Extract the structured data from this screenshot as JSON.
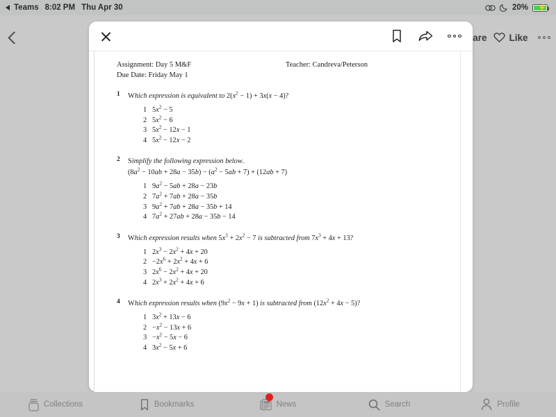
{
  "status_bar": {
    "back_app": "Teams",
    "time": "8:02 PM",
    "date": "Thu Apr 30",
    "battery_percent": "20%",
    "icons": [
      "link-icon",
      "moon-icon",
      "battery-charging-icon"
    ]
  },
  "page_toolbar": {
    "back_label": "",
    "share_label": "Share",
    "like_label": "Like",
    "more_label": ""
  },
  "modal": {
    "close_label": "",
    "bookmark_label": "",
    "share_label": "",
    "more_label": ""
  },
  "document": {
    "assignment": "Assignment: Day 5 M&F",
    "teacher": "Teacher: Candreva/Peterson",
    "due_date": "Due Date: Friday May 1",
    "questions": [
      {
        "number": "1",
        "prompt": "Which expression is equivalent to 2(x² − 1) + 3x(x − 4)?",
        "subline": "",
        "choices": [
          {
            "n": "1",
            "text": "5x² − 5"
          },
          {
            "n": "2",
            "text": "5x² − 6"
          },
          {
            "n": "3",
            "text": "5x² − 12x − 1"
          },
          {
            "n": "4",
            "text": "5x² − 12x − 2"
          }
        ]
      },
      {
        "number": "2",
        "prompt": "Simplify the following expression below.",
        "subline": "(8a² − 10ab + 28a − 35b) − (a² − 5ab + 7) + (12ab + 7)",
        "choices": [
          {
            "n": "1",
            "text": "9a² − 5ab + 28a − 23b"
          },
          {
            "n": "2",
            "text": "7a² + 7ab + 28a − 35b"
          },
          {
            "n": "3",
            "text": "9a² + 7ab + 28a − 35b + 14"
          },
          {
            "n": "4",
            "text": "7a² + 27ab + 28a − 35b − 14"
          }
        ]
      },
      {
        "number": "3",
        "prompt": "Which expression results when 5x³ + 2x² − 7 is subtracted from 7x³ + 4x + 13?",
        "subline": "",
        "choices": [
          {
            "n": "1",
            "text": "2x³ − 2x² + 4x + 20"
          },
          {
            "n": "2",
            "text": "−2x⁶ + 2x² + 4x + 6"
          },
          {
            "n": "3",
            "text": "2x⁶ − 2x² + 4x + 20"
          },
          {
            "n": "4",
            "text": "2x³ + 2x² + 4x + 6"
          }
        ]
      },
      {
        "number": "4",
        "prompt": "Which expression results when (9x² − 9x + 1) is subtracted from (12x² + 4x − 5)?",
        "subline": "",
        "choices": [
          {
            "n": "1",
            "text": "3x² + 13x − 6"
          },
          {
            "n": "2",
            "text": "−x² − 13x + 6"
          },
          {
            "n": "3",
            "text": "−x² − 5x − 6"
          },
          {
            "n": "4",
            "text": "3x² − 5x + 6"
          }
        ]
      }
    ]
  },
  "tabbar": {
    "items": [
      {
        "label": "Collections",
        "icon": "collections-icon",
        "badge": ""
      },
      {
        "label": "Bookmarks",
        "icon": "bookmark-icon",
        "badge": ""
      },
      {
        "label": "News",
        "icon": "news-icon",
        "badge": "dot"
      },
      {
        "label": "Search",
        "icon": "search-icon",
        "badge": ""
      },
      {
        "label": "Profile",
        "icon": "profile-icon",
        "badge": ""
      }
    ]
  },
  "colors": {
    "background": "#c9c9c9",
    "status_bar": "#c2c3c3",
    "sheet": "#ffffff",
    "badge_red": "#e02020",
    "battery_green": "#4cd04c",
    "tab_text": "#818181"
  }
}
